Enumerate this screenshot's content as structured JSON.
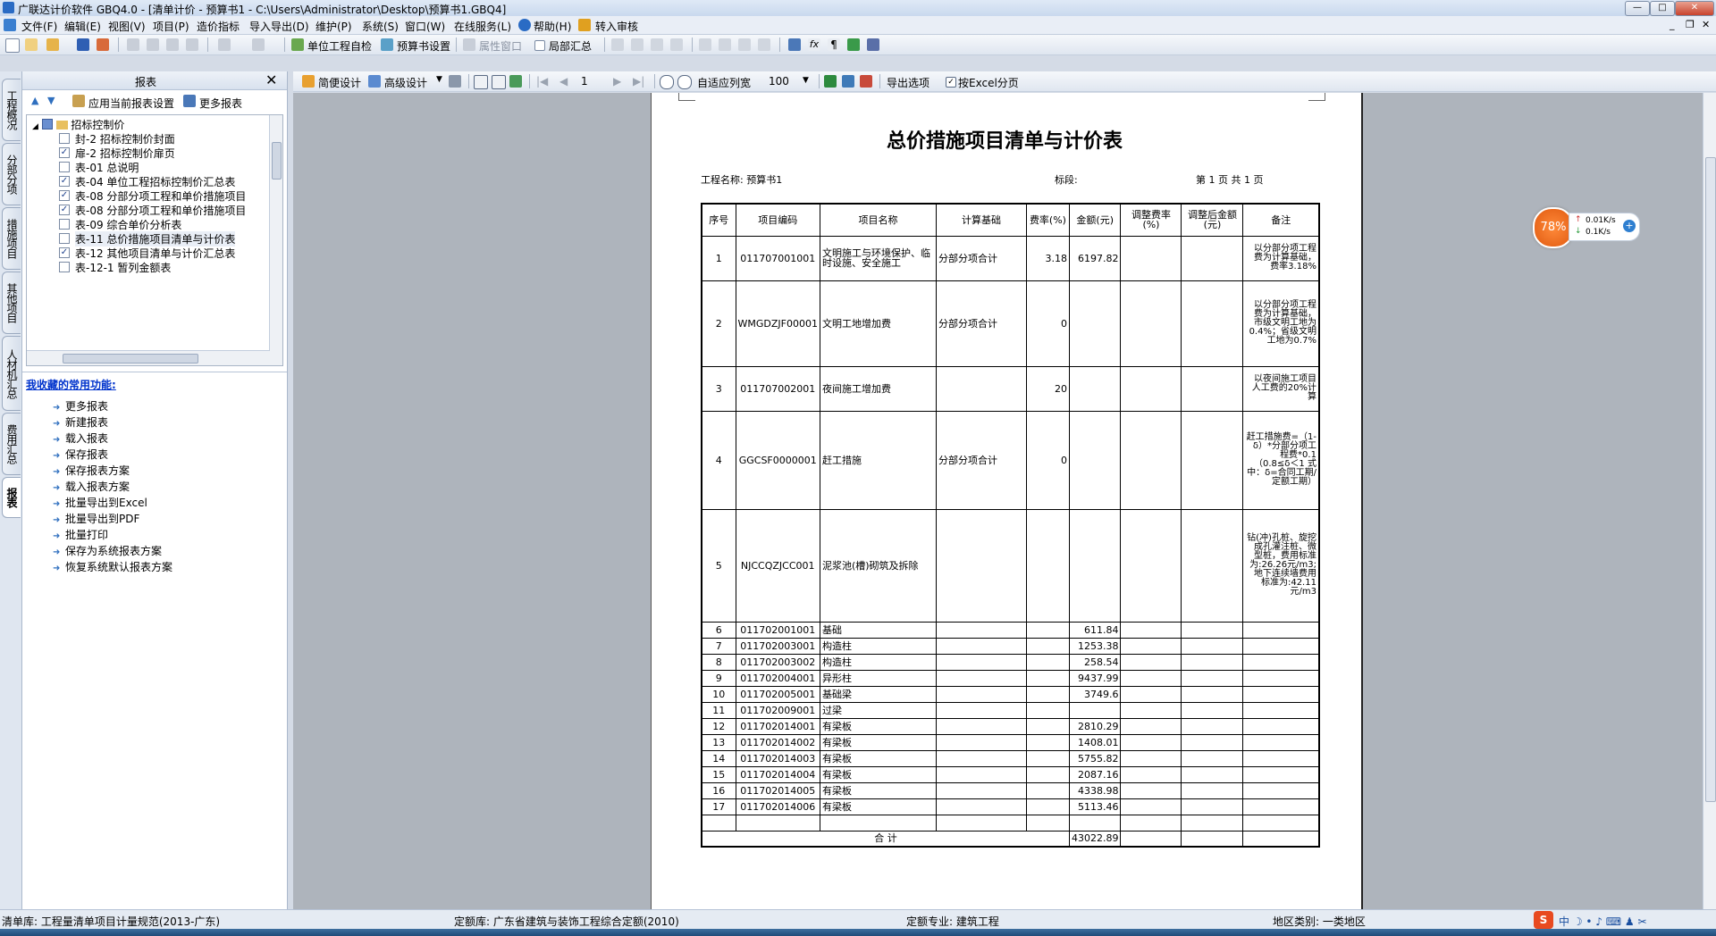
{
  "window": {
    "title": "广联达计价软件 GBQ4.0 - [清单计价 - 预算书1 - C:\\Users\\Administrator\\Desktop\\预算书1.GBQ4]",
    "min": "—",
    "max": "□",
    "close": "✕"
  },
  "menu": [
    "文件(F)",
    "编辑(E)",
    "视图(V)",
    "项目(P)",
    "造价指标",
    "导入导出(D)",
    "维护(P)",
    "系统(S)",
    "窗口(W)",
    "在线服务(L)",
    "帮助(H)",
    "转入审核"
  ],
  "toolbar1": {
    "self_check": "单位工程自检",
    "budget_settings": "预算书设置",
    "properties": "属性窗口",
    "local_summary": "局部汇总"
  },
  "toolbar2": {
    "simple_design": "简便设计",
    "advanced_design": "高级设计",
    "page": "1",
    "fit_width": "自适应列宽",
    "zoom": "100",
    "export_options": "导出选项",
    "excel_paging": "按Excel分页"
  },
  "vtabs": [
    "工程概况",
    "分部分项",
    "措施项目",
    "其他项目",
    "人材机汇总",
    "费用汇总",
    "报表"
  ],
  "panel": {
    "title": "报表",
    "apply_settings": "应用当前报表设置",
    "more_reports": "更多报表",
    "tree_root": "招标控制价",
    "tree_items": [
      {
        "label": "封-2  招标控制价封面",
        "checked": false
      },
      {
        "label": "扉-2  招标控制价扉页",
        "checked": true
      },
      {
        "label": "表-01  总说明",
        "checked": false
      },
      {
        "label": "表-04  单位工程招标控制价汇总表",
        "checked": true
      },
      {
        "label": "表-08  分部分项工程和单价措施项目",
        "checked": true
      },
      {
        "label": "表-08  分部分项工程和单价措施项目",
        "checked": true
      },
      {
        "label": "表-09  综合单价分析表",
        "checked": false
      },
      {
        "label": "表-11  总价措施项目清单与计价表",
        "checked": false
      },
      {
        "label": "表-12  其他项目清单与计价汇总表",
        "checked": true
      },
      {
        "label": "表-12-1  暂列金额表",
        "checked": false
      }
    ],
    "fav_title": "我收藏的常用功能:",
    "fav_items": [
      "更多报表",
      "新建报表",
      "载入报表",
      "保存报表",
      "保存报表方案",
      "载入报表方案",
      "批量导出到Excel",
      "批量导出到PDF",
      "批量打印",
      "保存为系统报表方案",
      "恢复系统默认报表方案"
    ]
  },
  "report": {
    "title": "总价措施项目清单与计价表",
    "project_label": "工程名称: 预算书1",
    "section_label": "标段:",
    "page_info": "第  1  页  共  1  页",
    "headers": [
      "序号",
      "项目编码",
      "项目名称",
      "计算基础",
      "费率(%)",
      "金额(元)",
      "调整费率(%)",
      "调整后金额(元)",
      "备注"
    ],
    "rows": [
      {
        "no": "1",
        "code": "011707001001",
        "name": "文明施工与环境保护、临时设施、安全施工",
        "base": "分部分项合计",
        "rate": "3.18",
        "amount": "6197.82",
        "note": "以分部分项工程费为计算基础，费率3.18%"
      },
      {
        "no": "2",
        "code": "WMGDZJF00001",
        "name": "文明工地增加费",
        "base": "分部分项合计",
        "rate": "0",
        "amount": "",
        "note": "以分部分项工程费为计算基础，市级文明工地为0.4%；省级文明工地为0.7%"
      },
      {
        "no": "3",
        "code": "011707002001",
        "name": "夜间施工增加费",
        "base": "",
        "rate": "20",
        "amount": "",
        "note": "以夜间施工项目人工费的20%计算"
      },
      {
        "no": "4",
        "code": "GGCSF0000001",
        "name": "赶工措施",
        "base": "分部分项合计",
        "rate": "0",
        "amount": "",
        "note": "赶工措施费=（1-δ）*分部分项工程费*0.1（0.8≤δ＜1 式中：δ=合同工期/定额工期）"
      },
      {
        "no": "5",
        "code": "NJCCQZJCC001",
        "name": "泥浆池(槽)砌筑及拆除",
        "base": "",
        "rate": "",
        "amount": "",
        "note": "钻(冲)孔桩、旋挖成孔灌注桩、微型桩，费用标准为:26.26元/m3;地下连续墙费用标准为:42.11元/m3"
      },
      {
        "no": "6",
        "code": "011702001001",
        "name": "基础",
        "base": "",
        "rate": "",
        "amount": "611.84",
        "note": ""
      },
      {
        "no": "7",
        "code": "011702003001",
        "name": "构造柱",
        "base": "",
        "rate": "",
        "amount": "1253.38",
        "note": ""
      },
      {
        "no": "8",
        "code": "011702003002",
        "name": "构造柱",
        "base": "",
        "rate": "",
        "amount": "258.54",
        "note": ""
      },
      {
        "no": "9",
        "code": "011702004001",
        "name": "异形柱",
        "base": "",
        "rate": "",
        "amount": "9437.99",
        "note": ""
      },
      {
        "no": "10",
        "code": "011702005001",
        "name": "基础梁",
        "base": "",
        "rate": "",
        "amount": "3749.6",
        "note": ""
      },
      {
        "no": "11",
        "code": "011702009001",
        "name": "过梁",
        "base": "",
        "rate": "",
        "amount": "",
        "note": ""
      },
      {
        "no": "12",
        "code": "011702014001",
        "name": "有梁板",
        "base": "",
        "rate": "",
        "amount": "2810.29",
        "note": ""
      },
      {
        "no": "13",
        "code": "011702014002",
        "name": "有梁板",
        "base": "",
        "rate": "",
        "amount": "1408.01",
        "note": ""
      },
      {
        "no": "14",
        "code": "011702014003",
        "name": "有梁板",
        "base": "",
        "rate": "",
        "amount": "5755.82",
        "note": ""
      },
      {
        "no": "15",
        "code": "011702014004",
        "name": "有梁板",
        "base": "",
        "rate": "",
        "amount": "2087.16",
        "note": ""
      },
      {
        "no": "16",
        "code": "011702014005",
        "name": "有梁板",
        "base": "",
        "rate": "",
        "amount": "4338.98",
        "note": ""
      },
      {
        "no": "17",
        "code": "011702014006",
        "name": "有梁板",
        "base": "",
        "rate": "",
        "amount": "5113.46",
        "note": ""
      }
    ],
    "total_label": "合      计",
    "total_amount": "43022.89"
  },
  "status": {
    "list_lib": "清单库:  工程量清单项目计量规范(2013-广东)",
    "quota_lib": "定额库:  广东省建筑与装饰工程综合定额(2010)",
    "quota_major": "定额专业:  建筑工程",
    "region": "地区类别:  一类地区"
  },
  "net_widget": {
    "percent": "78%",
    "up": "0.01K/s",
    "down": "0.1K/s"
  }
}
